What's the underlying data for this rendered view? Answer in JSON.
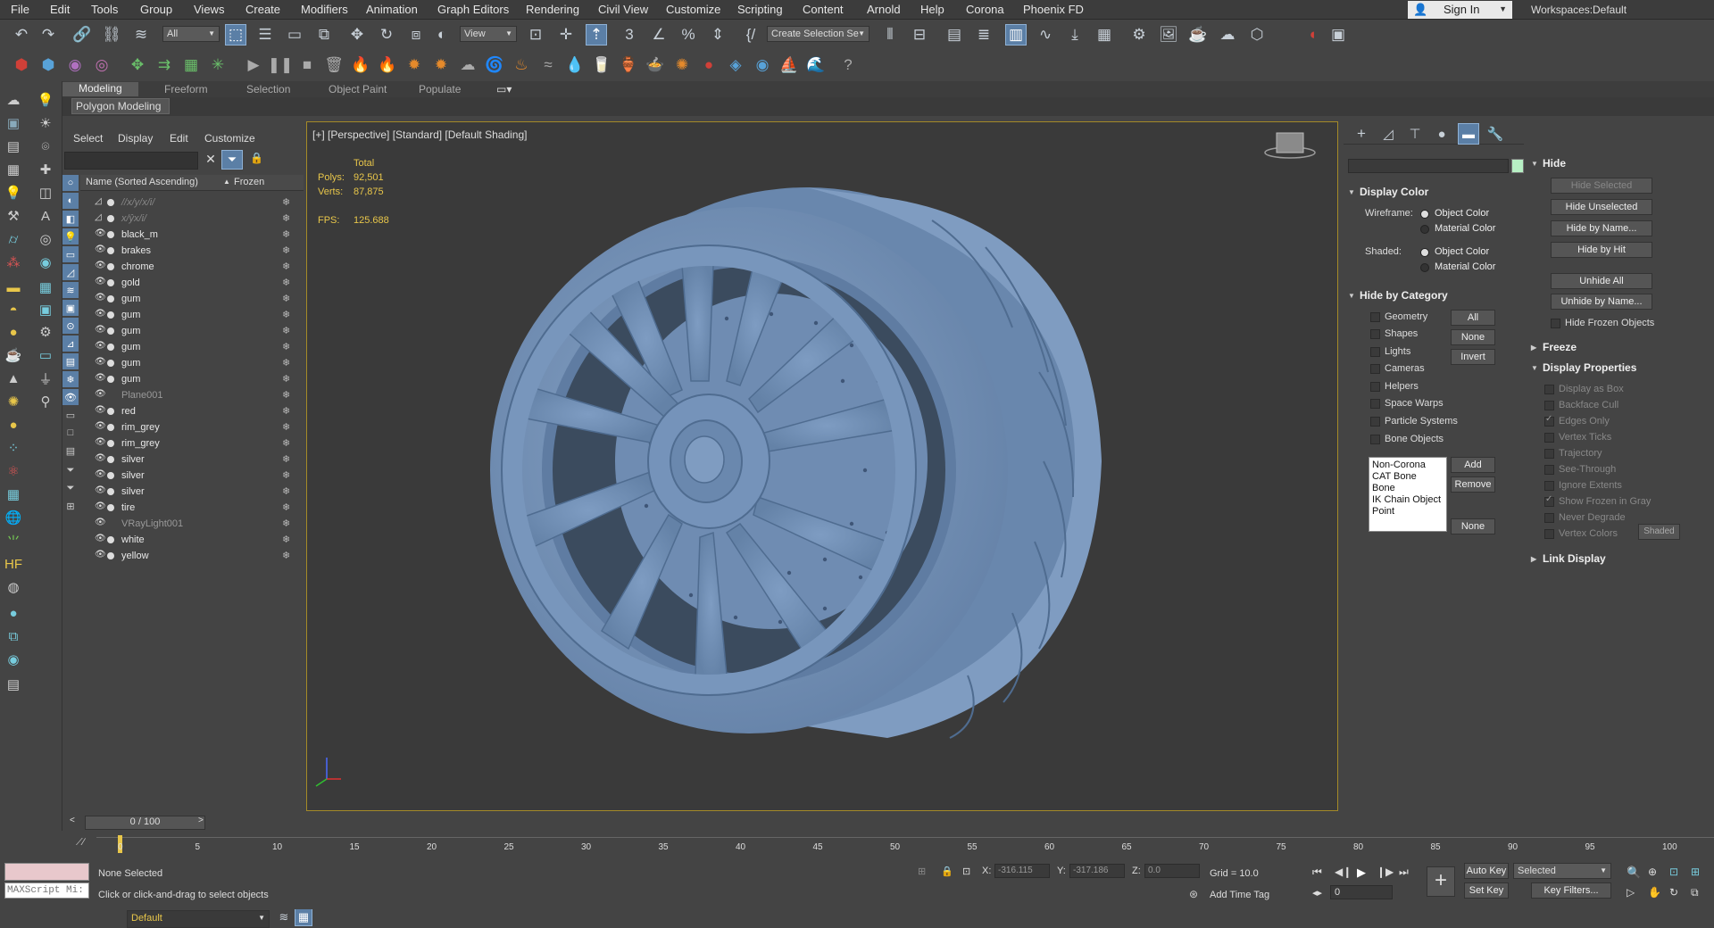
{
  "menu": [
    "File",
    "Edit",
    "Tools",
    "Group",
    "Views",
    "Create",
    "Modifiers",
    "Animation",
    "Graph Editors",
    "Rendering",
    "Civil View",
    "Customize",
    "Scripting",
    "Content",
    "Arnold",
    "Help",
    "Corona",
    "Phoenix FD"
  ],
  "account": {
    "sign_in": "Sign In",
    "workspaces_label": "Workspaces:",
    "workspace": "Default"
  },
  "toolbar": {
    "filter": "All",
    "refcoord": "View",
    "selection_set": "Create Selection Se"
  },
  "ribbon": {
    "tabs": [
      "Modeling",
      "Freeform",
      "Selection",
      "Object Paint",
      "Populate"
    ],
    "active": "Modeling",
    "panel": "Polygon Modeling"
  },
  "explorer": {
    "menu": [
      "Select",
      "Display",
      "Edit",
      "Customize"
    ],
    "col_name": "Name (Sorted Ascending)",
    "col_frozen": "Frozen",
    "rows": [
      {
        "name": "//x/y/x/i/",
        "style": "italic"
      },
      {
        "name": "x/ŷx/i/",
        "style": "italic"
      },
      {
        "name": "black_m",
        "style": "normal"
      },
      {
        "name": "brakes",
        "style": "normal"
      },
      {
        "name": "chrome",
        "style": "normal"
      },
      {
        "name": "gold",
        "style": "normal"
      },
      {
        "name": "gum",
        "style": "normal"
      },
      {
        "name": "gum",
        "style": "normal"
      },
      {
        "name": "gum",
        "style": "normal"
      },
      {
        "name": "gum",
        "style": "normal"
      },
      {
        "name": "gum",
        "style": "normal"
      },
      {
        "name": "gum",
        "style": "normal"
      },
      {
        "name": "Plane001",
        "style": "dim"
      },
      {
        "name": "red",
        "style": "normal"
      },
      {
        "name": "rim_grey",
        "style": "normal"
      },
      {
        "name": "rim_grey",
        "style": "normal"
      },
      {
        "name": "silver",
        "style": "normal"
      },
      {
        "name": "silver",
        "style": "normal"
      },
      {
        "name": "silver",
        "style": "normal"
      },
      {
        "name": "tire",
        "style": "normal"
      },
      {
        "name": "VRayLight001",
        "style": "dim"
      },
      {
        "name": "white",
        "style": "normal"
      },
      {
        "name": "yellow",
        "style": "normal"
      }
    ],
    "layer": "Default",
    "time_slider": "0 / 100"
  },
  "viewport": {
    "label": "[+] [Perspective] [Standard] [Default Shading]",
    "stats": {
      "total_label": "Total",
      "polys_label": "Polys:",
      "polys": "92,501",
      "verts_label": "Verts:",
      "verts": "87,875",
      "fps_label": "FPS:",
      "fps": "125.688"
    },
    "model_color": "#7b98bd"
  },
  "display_panel": {
    "display_color": {
      "title": "Display Color",
      "wireframe_label": "Wireframe:",
      "shaded_label": "Shaded:",
      "object_color": "Object Color",
      "material_color": "Material Color"
    },
    "hide_by_category": {
      "title": "Hide by Category",
      "items": [
        "Geometry",
        "Shapes",
        "Lights",
        "Cameras",
        "Helpers",
        "Space Warps",
        "Particle Systems",
        "Bone Objects"
      ],
      "buttons": [
        "All",
        "None",
        "Invert"
      ],
      "list": [
        "Non-Corona",
        "CAT Bone",
        "Bone",
        "IK Chain Object",
        "Point"
      ],
      "add": "Add",
      "remove": "Remove",
      "none": "None"
    }
  },
  "hide_panel": {
    "title": "Hide",
    "buttons": [
      "Hide Selected",
      "Hide Unselected",
      "Hide by Name...",
      "Hide by Hit",
      "Unhide All",
      "Unhide by Name..."
    ],
    "hide_frozen": "Hide Frozen Objects",
    "freeze_title": "Freeze",
    "props_title": "Display Properties",
    "props": [
      {
        "label": "Display as Box",
        "checked": false
      },
      {
        "label": "Backface Cull",
        "checked": false
      },
      {
        "label": "Edges Only",
        "checked": true
      },
      {
        "label": "Vertex Ticks",
        "checked": false
      },
      {
        "label": "Trajectory",
        "checked": false
      },
      {
        "label": "See-Through",
        "checked": false
      },
      {
        "label": "Ignore Extents",
        "checked": false
      },
      {
        "label": "Show Frozen in Gray",
        "checked": true
      },
      {
        "label": "Never Degrade",
        "checked": false
      },
      {
        "label": "Vertex Colors",
        "checked": false
      }
    ],
    "shaded_btn": "Shaded",
    "link_title": "Link Display"
  },
  "timeline": {
    "ticks": [
      "0",
      "5",
      "10",
      "15",
      "20",
      "25",
      "30",
      "35",
      "40",
      "45",
      "50",
      "55",
      "60",
      "65",
      "70",
      "75",
      "80",
      "85",
      "90",
      "95",
      "100"
    ]
  },
  "status": {
    "maxscript": "MAXScript Mi:",
    "none_selected": "None Selected",
    "hint": "Click or click-and-drag to select objects",
    "x_label": "X:",
    "x": "-316.115",
    "y_label": "Y:",
    "y": "-317.186",
    "z_label": "Z:",
    "z": "0.0",
    "grid": "Grid = 10.0",
    "add_time_tag": "Add Time Tag",
    "auto_key": "Auto Key",
    "set_key": "Set Key",
    "selected": "Selected",
    "key_filters": "Key Filters...",
    "frame": "0"
  }
}
